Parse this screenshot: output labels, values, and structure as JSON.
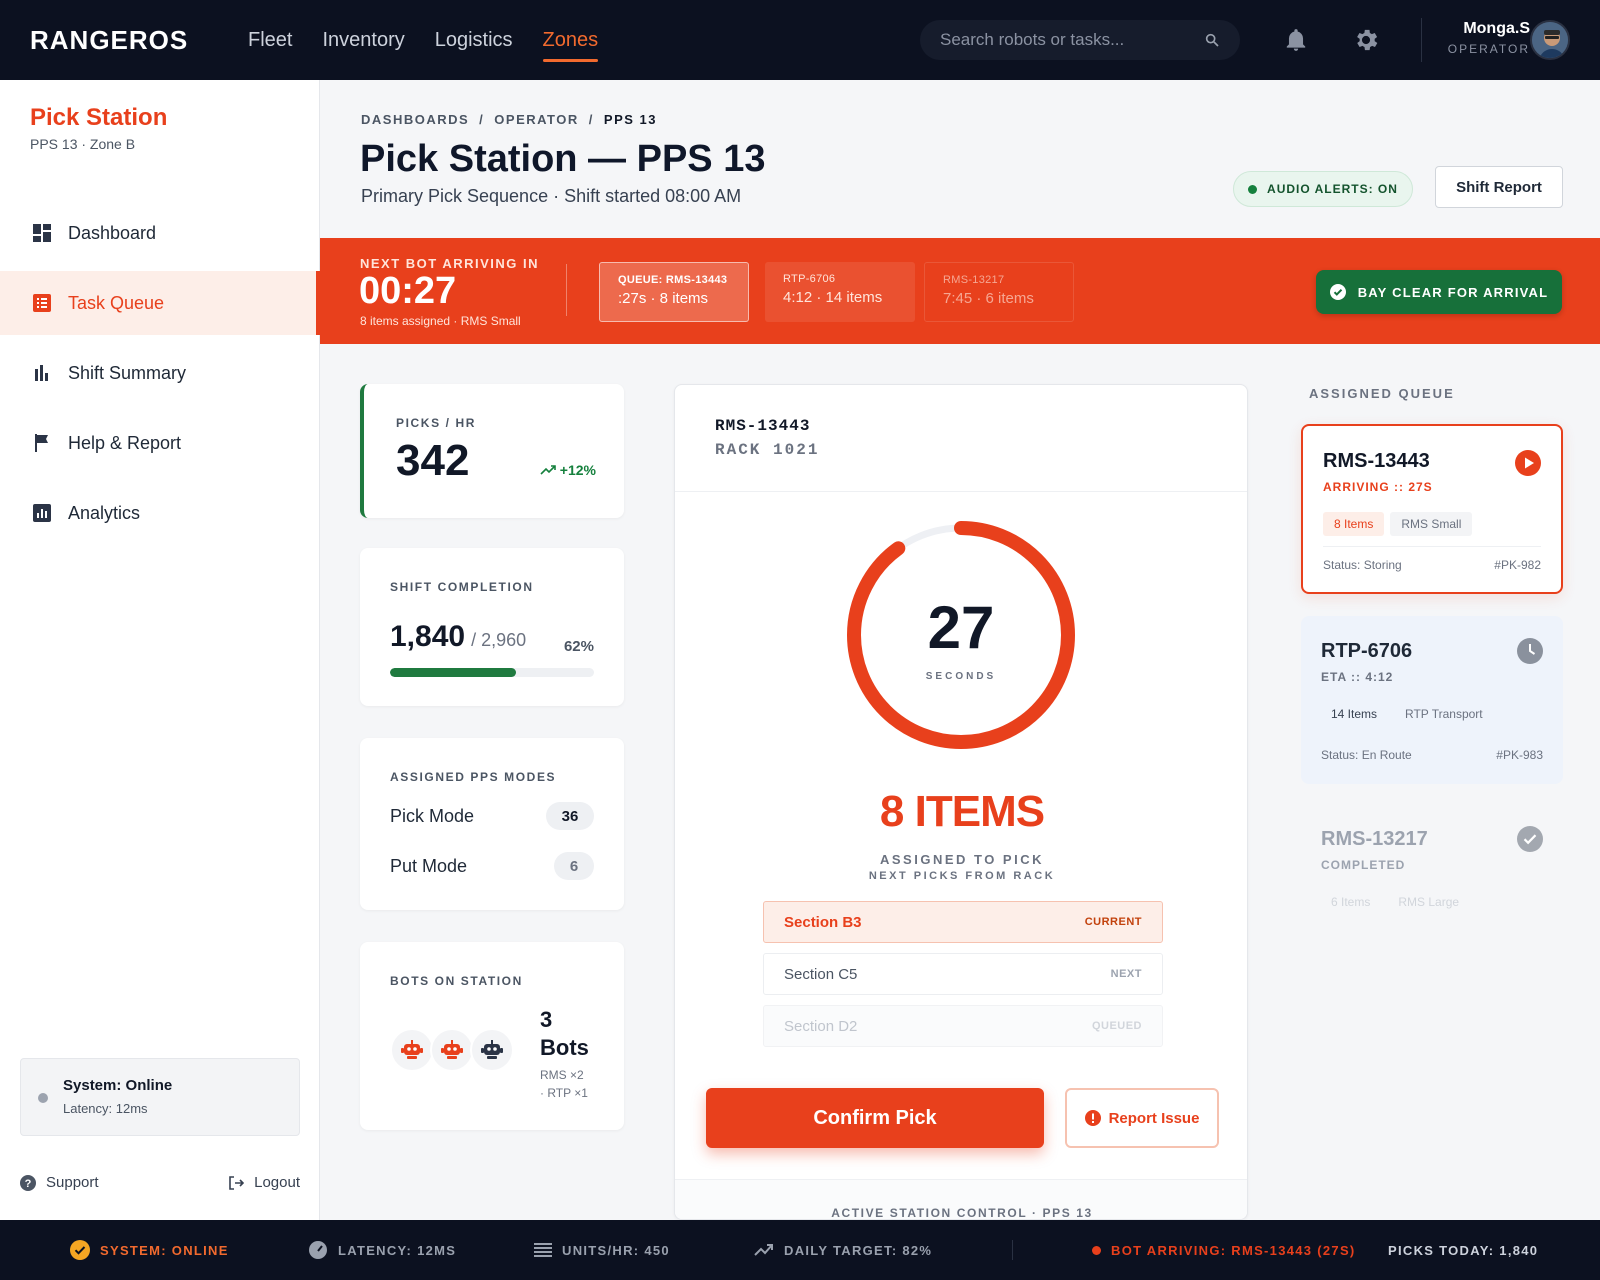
{
  "app": {
    "logo": "RANGEROS",
    "nav": [
      "Fleet",
      "Inventory",
      "Logistics",
      "Zones"
    ],
    "search_placeholder": "Search robots or tasks...",
    "user_name": "Monga.S",
    "user_role": "OPERATOR"
  },
  "sidebar": {
    "title": "Pick Station",
    "subtitle": "PPS 13 · Zone B",
    "items": [
      {
        "label": "Dashboard",
        "icon": "dashboard-icon"
      },
      {
        "label": "Task Queue",
        "icon": "list-icon"
      },
      {
        "label": "Shift Summary",
        "icon": "bar-chart-icon"
      },
      {
        "label": "Help & Report",
        "icon": "flag-icon"
      },
      {
        "label": "Analytics",
        "icon": "analytics-icon"
      }
    ],
    "system_status": "System: Online",
    "latency": "Latency: 12ms",
    "support": "Support",
    "logout": "Logout"
  },
  "header": {
    "breadcrumb": [
      "DASHBOARDS",
      "OPERATOR",
      "PPS 13"
    ],
    "title": "Pick Station — PPS 13",
    "subtitle": "Primary Pick Sequence · Shift started 08:00 AM",
    "audio_alerts": "AUDIO ALERTS: ON",
    "shift_report": "Shift Report"
  },
  "banner": {
    "label": "NEXT BOT ARRIVING IN",
    "timer": "00:27",
    "sub": "8 items assigned · RMS Small",
    "queue": [
      {
        "a": "QUEUE: RMS-13443",
        "b": ":27s · 8 items"
      },
      {
        "a": "RTP-6706",
        "b": "4:12 · 14 items"
      },
      {
        "a": "RMS-13217",
        "b": "7:45 · 6 items"
      }
    ],
    "bay_clear": "BAY CLEAR FOR ARRIVAL"
  },
  "kpi": {
    "picks_label": "PICKS / HR",
    "picks_value": "342",
    "picks_trend": "+12%",
    "completion_label": "SHIFT COMPLETION",
    "completion_value": "1,840",
    "completion_total": "/ 2,960",
    "completion_pct": "62%",
    "completion_fraction": 0.62,
    "modes_label": "ASSIGNED PPS MODES",
    "modes": [
      {
        "name": "Pick Mode",
        "count": "36"
      },
      {
        "name": "Put Mode",
        "count": "6"
      }
    ],
    "bots_label": "BOTS ON STATION",
    "bots_count": "3",
    "bots_word": "Bots",
    "bots_breakdown": "RMS ×2",
    "bots_breakdown2": "· RTP ×1"
  },
  "main": {
    "bot_id": "RMS-13443",
    "rack": "RACK 1021",
    "seconds": "27",
    "seconds_label": "SECONDS",
    "timer_fraction": 0.9,
    "items": "8 ITEMS",
    "assigned": "ASSIGNED TO PICK",
    "next_picks": "NEXT PICKS FROM RACK",
    "sections": [
      {
        "name": "Section B3",
        "state": "CURRENT"
      },
      {
        "name": "Section C5",
        "state": "NEXT"
      },
      {
        "name": "Section D2",
        "state": "QUEUED"
      }
    ],
    "confirm": "Confirm Pick",
    "report": "Report Issue",
    "footer": "ACTIVE STATION CONTROL · PPS 13"
  },
  "queue": {
    "title": "ASSIGNED QUEUE",
    "cards": [
      {
        "id": "RMS-13443",
        "status_line": "ARRIVING :: 27S",
        "tags": [
          "8 Items",
          "RMS Small"
        ],
        "status": "Status: Storing",
        "ref": "#PK-982"
      },
      {
        "id": "RTP-6706",
        "status_line": "ETA :: 4:12",
        "tags": [
          "14 Items",
          "RTP Transport"
        ],
        "status": "Status: En Route",
        "ref": "#PK-983"
      },
      {
        "id": "RMS-13217",
        "status_line": "COMPLETED",
        "tags": [
          "6 Items",
          "RMS Large"
        ]
      }
    ]
  },
  "status_bar": {
    "system": "SYSTEM: ONLINE",
    "latency": "LATENCY: 12MS",
    "units": "UNITS/HR: 450",
    "target": "DAILY TARGET: 82%",
    "arriving": "BOT ARRIVING: RMS-13443 (27S)",
    "picks_today": "PICKS TODAY: 1,840"
  },
  "colors": {
    "accent": "#e8401c",
    "success": "#17703a",
    "dark": "#0c1120"
  }
}
